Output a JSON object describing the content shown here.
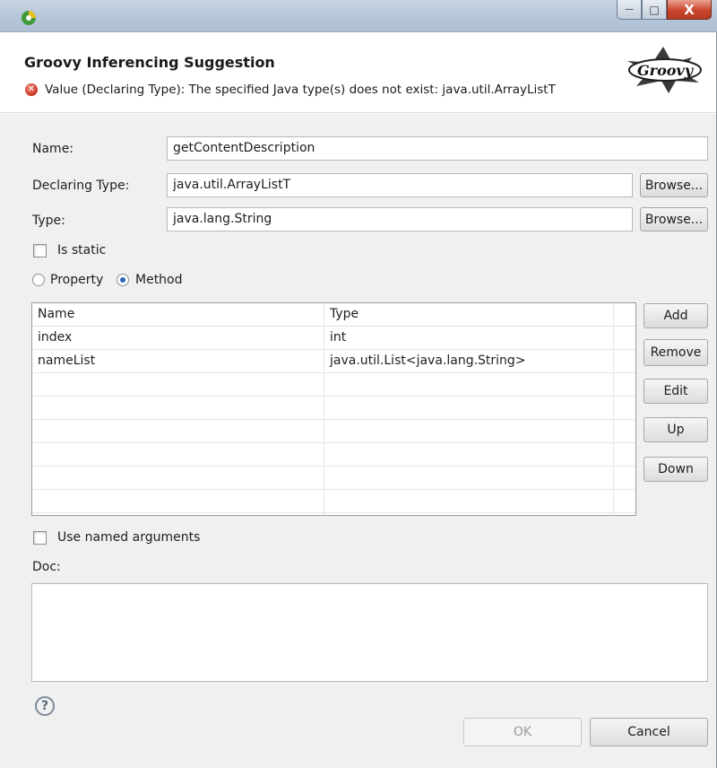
{
  "dialog": {
    "title": "Groovy Inferencing Suggestion",
    "error_message": "Value (Declaring Type): The specified Java type(s) does not exist: java.util.ArrayListT",
    "logo_text": "Groovy"
  },
  "window_controls": {
    "minimize": "—",
    "maximize": "□",
    "close": "X"
  },
  "form": {
    "name_label": "Name:",
    "name_value": "getContentDescription",
    "declaring_type_label": "Declaring Type:",
    "declaring_type_value": "java.util.ArrayListT",
    "type_label": "Type:",
    "type_value": "java.lang.String",
    "browse_label": "Browse...",
    "is_static_label": "Is static",
    "property_label": "Property",
    "method_label": "Method",
    "selected_kind": "Method"
  },
  "params_table": {
    "columns": [
      "Name",
      "Type"
    ],
    "rows": [
      {
        "name": "index",
        "type": "int"
      },
      {
        "name": "nameList",
        "type": "java.util.List<java.lang.String>"
      }
    ],
    "buttons": {
      "add": "Add",
      "remove": "Remove",
      "edit": "Edit",
      "up": "Up",
      "down": "Down"
    }
  },
  "named_args_label": "Use named arguments",
  "doc_label": "Doc:",
  "footer": {
    "help": "?",
    "ok": "OK",
    "cancel": "Cancel"
  },
  "colors": {
    "background": "#f0f0f0",
    "error": "#c9321f",
    "titlebar": "#b8c8da"
  }
}
